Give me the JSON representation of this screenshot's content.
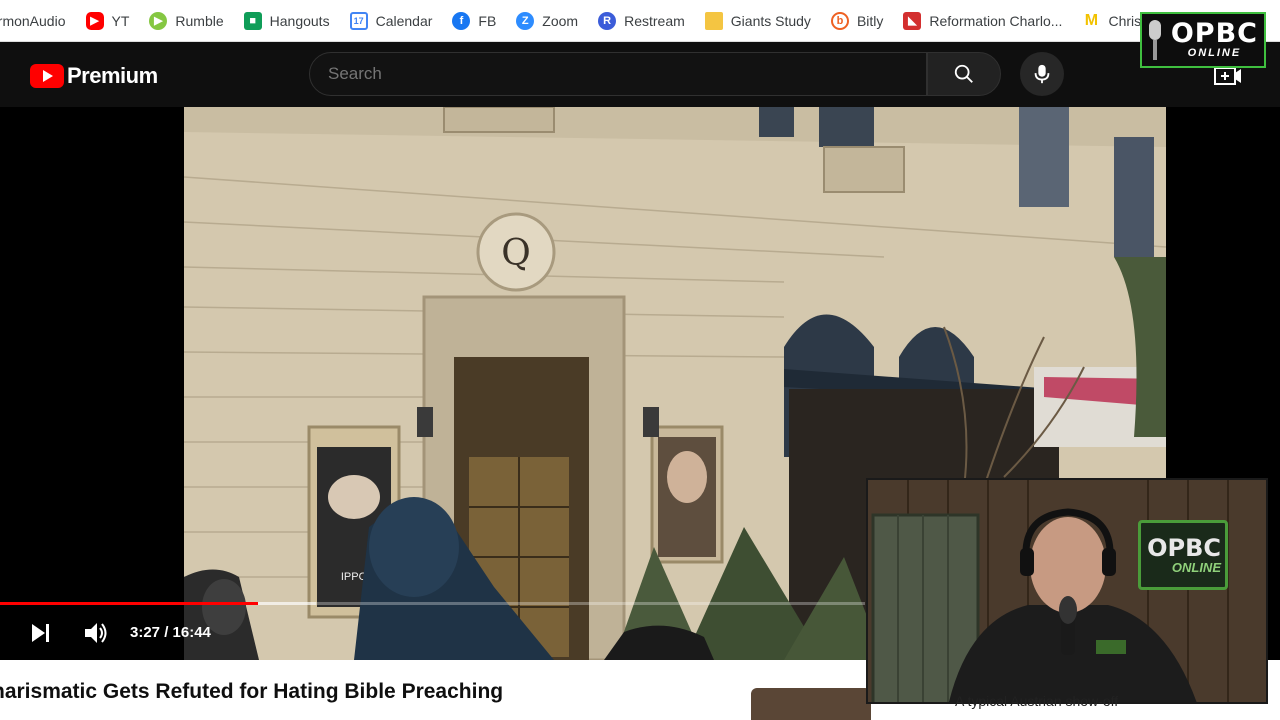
{
  "bookmarks": [
    {
      "label": "ermonAudio",
      "icon": "sermonaudio-icon",
      "color": "#ffffff"
    },
    {
      "label": "YT",
      "icon": "youtube-icon",
      "color": "#ff0000"
    },
    {
      "label": "Rumble",
      "icon": "rumble-icon",
      "color": "#85c742"
    },
    {
      "label": "Hangouts",
      "icon": "hangouts-icon",
      "color": "#0f9d58"
    },
    {
      "label": "Calendar",
      "icon": "calendar-icon",
      "color": "#4285f4"
    },
    {
      "label": "FB",
      "icon": "facebook-icon",
      "color": "#1877f2"
    },
    {
      "label": "Zoom",
      "icon": "zoom-icon",
      "color": "#2d8cff"
    },
    {
      "label": "Restream",
      "icon": "restream-icon",
      "color": "#3b5cd9"
    },
    {
      "label": "Giants Study",
      "icon": "folder-icon",
      "color": "#f4c542"
    },
    {
      "label": "Bitly",
      "icon": "bitly-icon",
      "color": "#ee6123"
    },
    {
      "label": "Reformation Charlo...",
      "icon": "reformation-icon",
      "color": "#d32f2f"
    },
    {
      "label": "Christ",
      "icon": "m-icon",
      "color": "#f2c200"
    }
  ],
  "header": {
    "logo_text": "Premium",
    "search_placeholder": "Search"
  },
  "opbc_logo": {
    "big": "OPBC",
    "small": "ONLINE"
  },
  "player": {
    "time": "3:27 / 16:44",
    "progress_fraction": 0.207,
    "buffered_fraction": 0.2
  },
  "video": {
    "title": "harismatic Gets Refuted for Hating Bible Preaching"
  },
  "webcam": {
    "caption": "A typical Austrian show-off"
  },
  "colors": {
    "accent": "#ff0000",
    "brand_green": "#3fbf3f"
  }
}
